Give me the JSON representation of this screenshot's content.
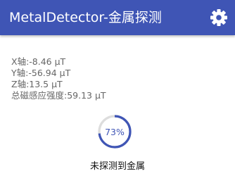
{
  "app_bar": {
    "title": "MetalDetector-金属探测",
    "settings_icon": "gear-icon",
    "background": "#3f55b5"
  },
  "readings": [
    {
      "label": "X轴:",
      "value": "-8.46 μT"
    },
    {
      "label": "Y轴:",
      "value": "-56.94 μT"
    },
    {
      "label": "Z轴:",
      "value": "13.5 μT"
    },
    {
      "label": "总磁感应强度:",
      "value": "59.13 μT"
    }
  ],
  "gauge": {
    "label": "73%",
    "fraction": 0.73,
    "color": "#3f55b5",
    "track_color": "#dddddd"
  },
  "status_text": "未探测到金属"
}
